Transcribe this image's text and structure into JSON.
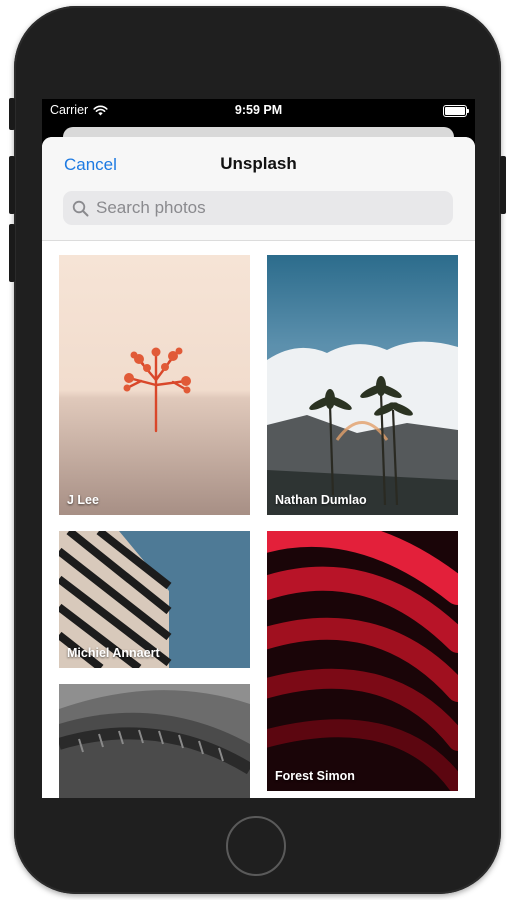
{
  "status_bar": {
    "carrier": "Carrier",
    "time": "9:59 PM"
  },
  "nav": {
    "cancel_label": "Cancel",
    "title": "Unsplash"
  },
  "search": {
    "placeholder": "Search photos",
    "value": ""
  },
  "photos": [
    {
      "credit": "J Lee",
      "subject": "red-leaf-photo"
    },
    {
      "credit": "Nathan Dumlao",
      "subject": "palm-trees-rainbow-photo"
    },
    {
      "credit": "Michiel Annaert",
      "subject": "building-balconies-photo"
    },
    {
      "credit": "Forest Simon",
      "subject": "red-abstract-photo"
    },
    {
      "credit": "",
      "subject": "curved-concrete-photo"
    }
  ],
  "colors": {
    "accent": "#1d7ae2",
    "nav_background": "#f7f7f7",
    "search_background": "#e8e8ea"
  }
}
